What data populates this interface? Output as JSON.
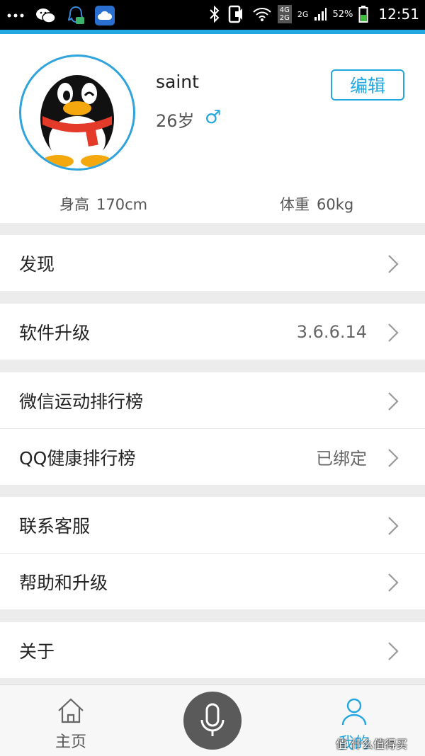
{
  "status_bar": {
    "time": "12:51",
    "battery": "52%",
    "network_top": "4G",
    "network_bottom": "2G",
    "network2": "2G",
    "icons": [
      "more-dots-icon",
      "wechat-icon",
      "qq-icon",
      "cloud-app-icon",
      "bluetooth-icon",
      "ring-vibrate-icon",
      "wifi-icon",
      "signal-icon",
      "battery-icon"
    ]
  },
  "profile": {
    "username": "saint",
    "age": "26岁",
    "gender_symbol": "♂",
    "edit_label": "编辑",
    "height_label": "身高",
    "height_value": "170cm",
    "weight_label": "体重",
    "weight_value": "60kg"
  },
  "menu": {
    "discover": "发现",
    "software_upgrade": "软件升级",
    "software_version": "3.6.6.14",
    "wechat_ranking": "微信运动排行榜",
    "qq_ranking": "QQ健康排行榜",
    "qq_ranking_status": "已绑定",
    "contact_service": "联系客服",
    "help_upgrade": "帮助和升级",
    "about": "关于"
  },
  "bottom_nav": {
    "home_label": "主页",
    "mine_label": "我的"
  },
  "watermark": "值 什么值得买",
  "colors": {
    "accent": "#23a7e0",
    "status_bar_bg": "#000000",
    "page_bg": "#ececec",
    "mic_button": "#5a5a5a"
  }
}
